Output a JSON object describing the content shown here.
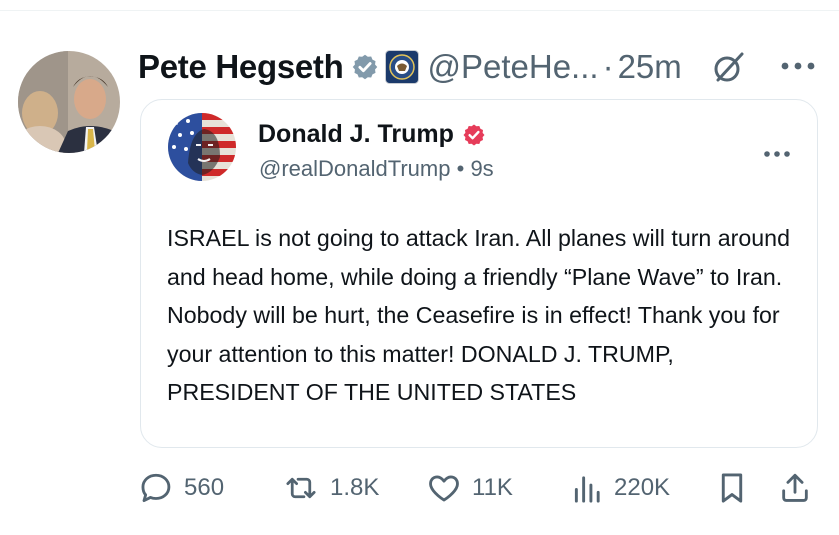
{
  "post": {
    "author_name": "Pete Hegseth",
    "handle": "@PeteHe...",
    "separator": "·",
    "time": "25m"
  },
  "quoted": {
    "author_name": "Donald J. Trump",
    "handle": "@realDonaldTrump",
    "bullet": "•",
    "time": "9s",
    "text": "ISRAEL is not going to attack Iran. All planes will turn around and head home, while doing a friendly “Plane Wave” to Iran. Nobody will be hurt, the Ceasefire is in effect! Thank you for your attention to this matter! DONALD J. TRUMP, PRESIDENT OF THE UNITED STATES"
  },
  "actions": {
    "replies": "560",
    "reposts": "1.8K",
    "likes": "11K",
    "views": "220K"
  },
  "colors": {
    "verified_blue": "#829aab",
    "quote_verified": "#e63c5a",
    "muted_text": "#536471",
    "text": "#0f1419"
  },
  "icons": {
    "verified": "verified-badge-icon",
    "government": "government-affiliation-icon",
    "grok": "grok-icon",
    "more": "more-icon",
    "reply": "reply-icon",
    "repost": "repost-icon",
    "like": "heart-icon",
    "views": "views-icon",
    "bookmark": "bookmark-icon",
    "share": "share-icon"
  }
}
